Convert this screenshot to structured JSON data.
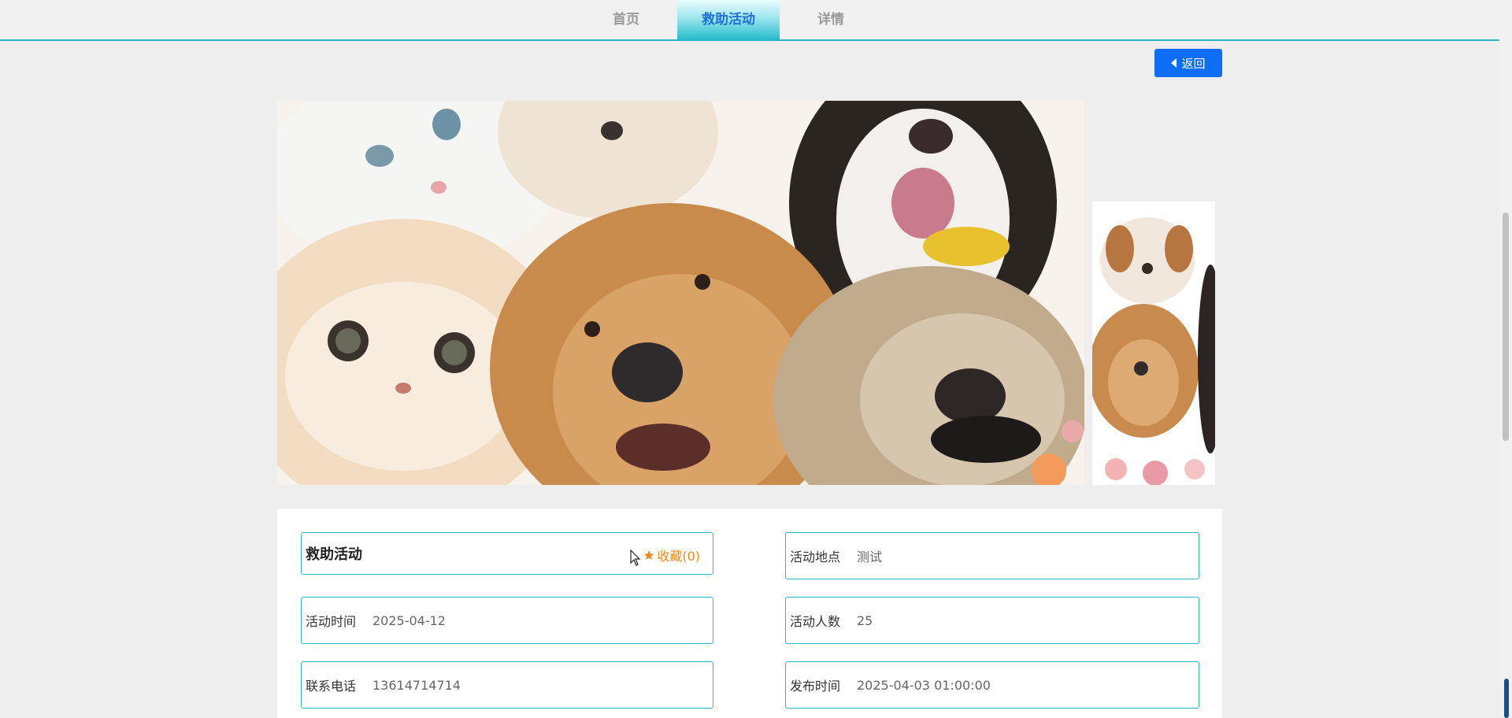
{
  "nav": {
    "tabs": [
      {
        "label": "首页"
      },
      {
        "label": "救助活动"
      },
      {
        "label": "详情"
      }
    ],
    "active_tab": "救助活动",
    "accent": "#27b6c6"
  },
  "back_button": {
    "label": "返回",
    "color": "#0d6ef5"
  },
  "detail": {
    "title": "救助活动",
    "favorite_label": "收藏(0)",
    "fields": {
      "location": {
        "label": "活动地点",
        "value": "测试"
      },
      "date": {
        "label": "活动时间",
        "value": "2025-04-12"
      },
      "people": {
        "label": "活动人数",
        "value": "25"
      },
      "phone": {
        "label": "联系电话",
        "value": "13614714714"
      },
      "published": {
        "label": "发布时间",
        "value": "2025-04-03 01:00:00"
      }
    }
  },
  "icons": {
    "back": "caret-left-icon",
    "favorite": "star-icon"
  }
}
